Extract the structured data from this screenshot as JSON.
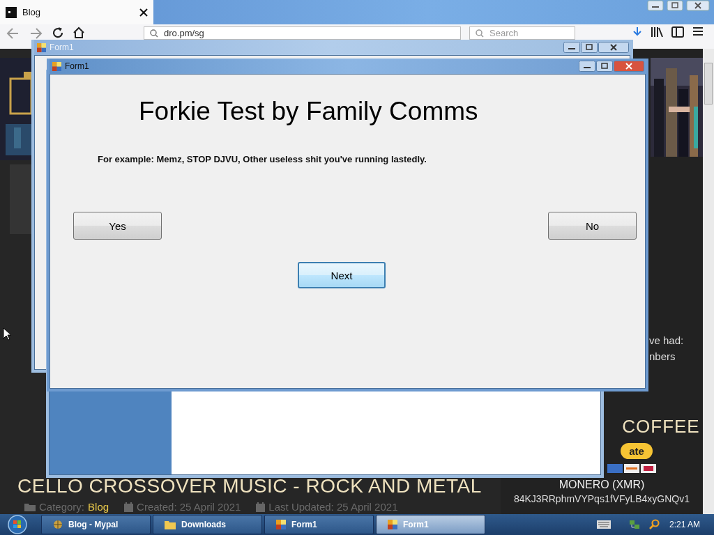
{
  "browser": {
    "tab_title": "Blog",
    "address": "dro.pm/sg",
    "search_placeholder": "Search"
  },
  "web_page": {
    "sidebar_lines": [
      "ve had:",
      "nbers"
    ],
    "coffee_heading": "COFFEE",
    "donate_button": "ate",
    "monero_heading": "MONERO (XMR)",
    "monero_address": "84KJ3RRphmVYPqs1fVFyLB4xyGNQv1",
    "article_title": "CELLO CROSSOVER MUSIC - ROCK AND METAL",
    "meta": [
      {
        "kind": "category",
        "label": "Category:",
        "value": "Blog"
      },
      {
        "kind": "date",
        "label": "Created: 25 April 2021"
      },
      {
        "kind": "date",
        "label": "Last Updated: 25 April 2021"
      }
    ]
  },
  "windows": [
    {
      "kind": "blank",
      "title": "Form1",
      "active": false
    },
    {
      "kind": "panel",
      "active": false
    },
    {
      "kind": "dialog",
      "title": "Form1",
      "active": true,
      "heading": "Forkie Test by Family Comms",
      "text": "For example: Memz, STOP DJVU, Other useless shit you've running lastedly.",
      "buttons": [
        {
          "label": "Yes",
          "focused": false
        },
        {
          "label": "No",
          "focused": false
        },
        {
          "label": "Next",
          "focused": true
        }
      ]
    }
  ],
  "taskbar": {
    "items": [
      {
        "kind": "browser",
        "label": "Blog - Mypal",
        "selected": false
      },
      {
        "kind": "folder",
        "label": "Downloads",
        "selected": false
      },
      {
        "kind": "form",
        "label": "Form1",
        "selected": false
      },
      {
        "kind": "form",
        "label": "Form1",
        "selected": true
      }
    ],
    "clock": "2:21 AM"
  }
}
